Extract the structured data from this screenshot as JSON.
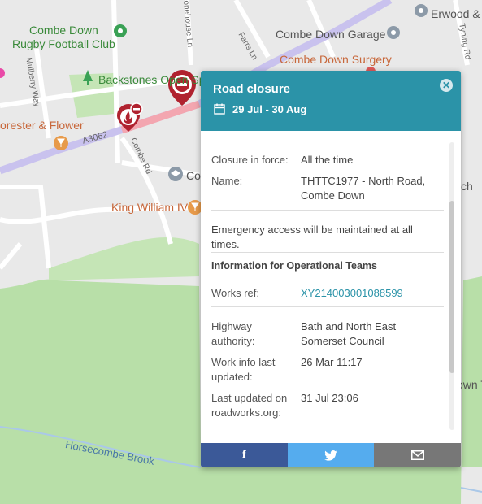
{
  "map": {
    "labels": {
      "combe_down_rugby": "Combe Down\nRugby Football Club",
      "backstones": "Backstones Open Sp",
      "forester_flower": "orester & Flower",
      "king_william": "King William IV",
      "combe_down_garage": "Combe Down Garage",
      "combe_down_surgery": "Combe Down Surgery",
      "erwood": "Erwood &",
      "co_partial": "Co",
      "ch_partial": "ch",
      "own_partial": "own T",
      "horsecombe_brook": "Horsecombe Brook",
      "a3062": "A3062",
      "combe_rd": "Combe Rd",
      "mulberry_way": "Mulberry Way",
      "farrs_ln": "Farrs Ln",
      "tyning_rd": "Tyning Rd",
      "stonehouse_ln": "onehouse Ln"
    },
    "colors": {
      "park": "#b8dfa8",
      "closure_road": "#f3a6b0",
      "main_road": "#c9c2ee",
      "pin_red": "#b0222f",
      "water": "#aac8e8"
    }
  },
  "popup": {
    "title": "Road closure",
    "date_range": "29 Jul - 30 Aug",
    "closure_in_force_label": "Closure in force:",
    "closure_in_force_value": "All the time",
    "name_label": "Name:",
    "name_value": "THTTC1977 - North Road, Combe Down",
    "emergency_note": "Emergency access will be maintained at all times.",
    "ops_heading": "Information for Operational Teams",
    "works_ref_label": "Works ref:",
    "works_ref_value": "XY214003001088599",
    "highway_authority_label": "Highway authority:",
    "highway_authority_value": "Bath and North East Somerset Council",
    "work_info_label": "Work info last updated:",
    "work_info_value": "26 Mar 11:17",
    "last_updated_label": "Last updated on roadworks.org:",
    "last_updated_value": "31 Jul 23:06",
    "share": {
      "facebook": "f",
      "twitter": "twitter-icon",
      "email": "email-icon"
    }
  }
}
